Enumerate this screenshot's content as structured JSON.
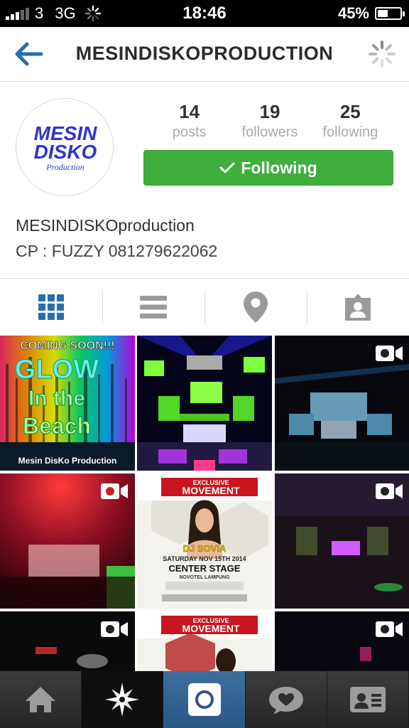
{
  "status_bar": {
    "carrier": "3",
    "network": "3G",
    "time": "18:46",
    "battery": "45%",
    "battery_level": 0.45
  },
  "nav": {
    "title": "MESINDISKOPRODUCTION"
  },
  "profile": {
    "avatar_text_line1": "MESIN",
    "avatar_text_line2": "DISKO",
    "avatar_text_line3": "Production",
    "posts_count": "14",
    "posts_label": "posts",
    "followers_count": "19",
    "followers_label": "followers",
    "following_count": "25",
    "following_label": "following",
    "follow_button_label": "Following",
    "display_name": "MESINDISKOproduction",
    "bio": "CP : FUZZY 081279622062"
  },
  "view_tabs": [
    "grid-icon",
    "list-icon",
    "location-pin-icon",
    "tagged-person-icon"
  ],
  "grid": {
    "tile1_line1": "COMING SOON!!!",
    "tile1_line2": "GLOW",
    "tile1_line3": "In the",
    "tile1_line4": "Beach",
    "tile1_line5": "Mesin DisKo Production",
    "tile5_banner1": "EXCLUSIVE",
    "tile5_banner2": "MOVEMENT",
    "tile5_dj": "DJ SOVIA",
    "tile5_date": "SATURDAY NOV 15TH 2014",
    "tile5_venue": "CENTER STAGE",
    "tile5_venue2": "NOVOTEL LAMPUNG",
    "tile8_banner1": "EXCLUSIVE",
    "tile8_banner2": "MOVEMENT"
  },
  "bottom_tabs": [
    "home-icon",
    "explore-icon",
    "camera-icon",
    "activity-icon",
    "profile-icon"
  ],
  "colors": {
    "follow_green": "#3fae3c",
    "tab_blue": "#2b5784",
    "nav_blue": "#2a6db0"
  }
}
